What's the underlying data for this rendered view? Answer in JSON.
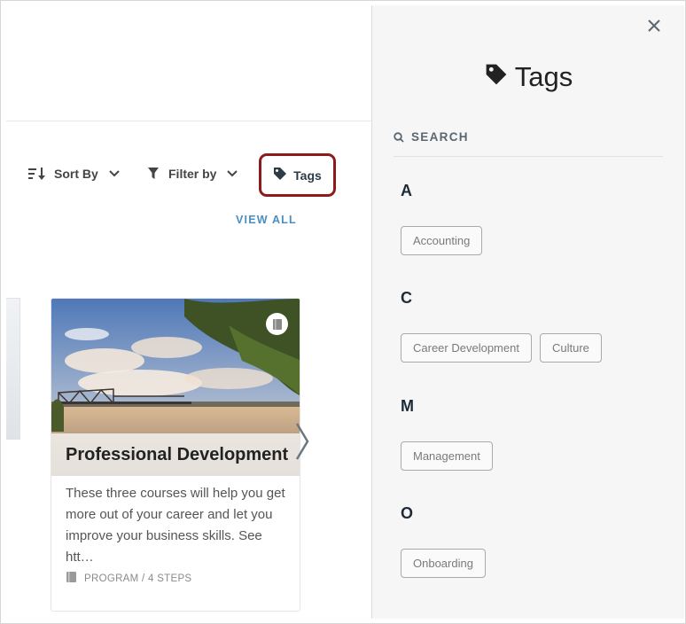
{
  "toolbar": {
    "sort_label": "Sort By",
    "filter_label": "Filter by",
    "tags_label": "Tags",
    "view_all": "VIEW ALL"
  },
  "card": {
    "title": "Professional Development",
    "description": "These three courses will help you get more out of your career and let you improve your business skills. See htt…",
    "meta": "PROGRAM / 4 STEPS"
  },
  "panel": {
    "title": "Tags",
    "search_placeholder": "SEARCH",
    "groups": [
      {
        "letter": "A",
        "tags": [
          "Accounting"
        ]
      },
      {
        "letter": "C",
        "tags": [
          "Career Development",
          "Culture"
        ]
      },
      {
        "letter": "M",
        "tags": [
          "Management"
        ]
      },
      {
        "letter": "O",
        "tags": [
          "Onboarding"
        ]
      }
    ]
  },
  "colors": {
    "highlight_border": "#8e1b1b",
    "link": "#4a8ec2",
    "panel_bg": "#f6f6f6"
  },
  "icons": [
    "sort-icon",
    "chevron-down-icon",
    "filter-icon",
    "tag-icon",
    "book-icon",
    "chevron-right-icon",
    "close-icon",
    "search-icon"
  ]
}
